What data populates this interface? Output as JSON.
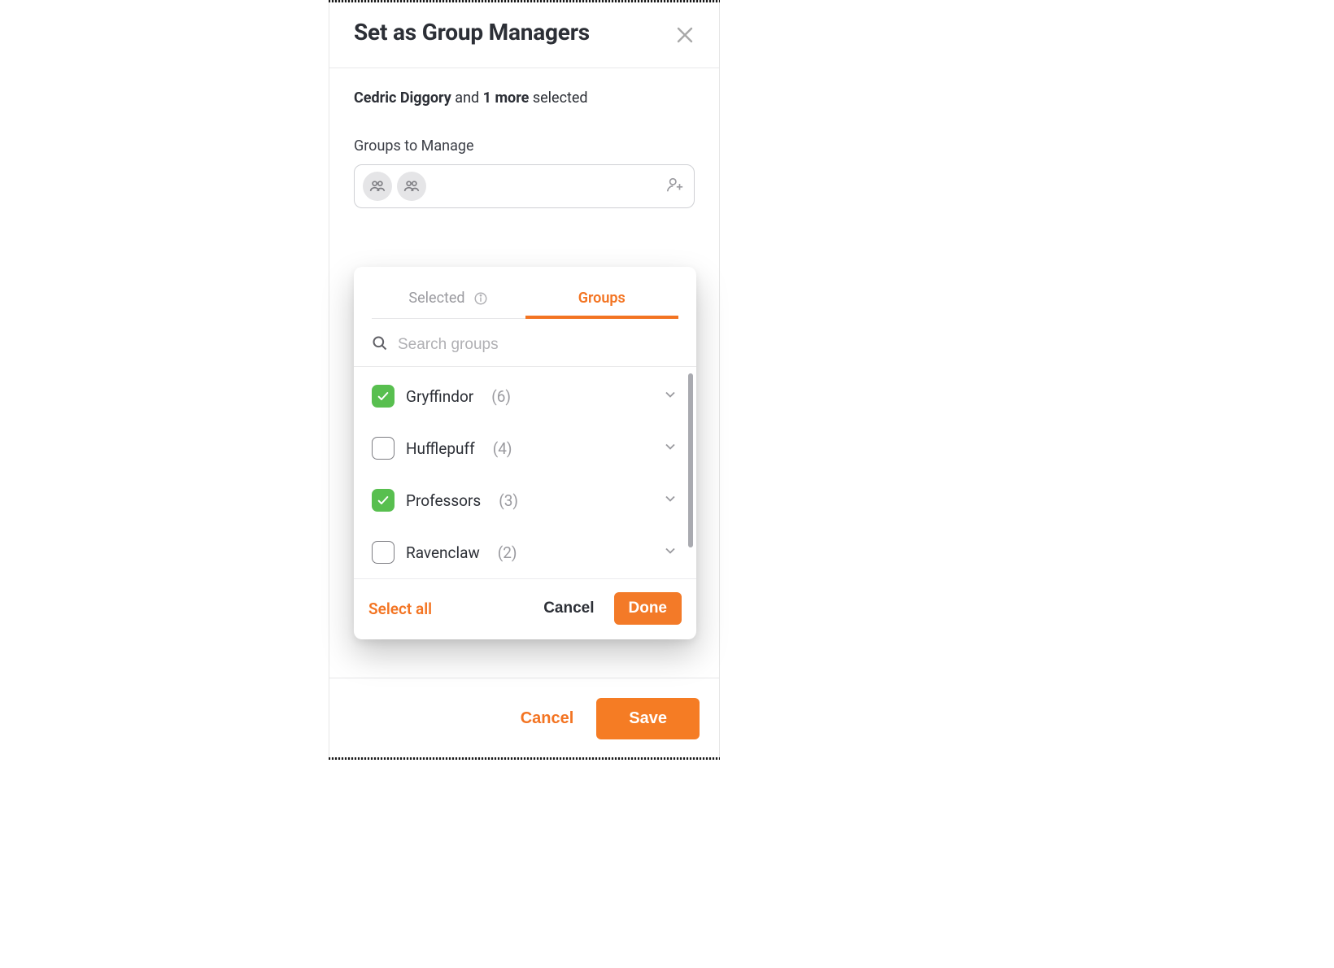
{
  "modal": {
    "title": "Set as Group Managers",
    "selection": {
      "name": "Cedric Diggory",
      "middle_text": " and ",
      "more_count": "1 more",
      "trailing_text": " selected"
    },
    "section_label": "Groups to Manage"
  },
  "dropdown": {
    "tabs": {
      "selected": "Selected",
      "groups": "Groups"
    },
    "search_placeholder": "Search groups",
    "items": [
      {
        "name": "Gryffindor",
        "count": "(6)",
        "checked": true
      },
      {
        "name": "Hufflepuff",
        "count": "(4)",
        "checked": false
      },
      {
        "name": "Professors",
        "count": "(3)",
        "checked": true
      },
      {
        "name": "Ravenclaw",
        "count": "(2)",
        "checked": false
      }
    ],
    "footer": {
      "select_all": "Select all",
      "cancel": "Cancel",
      "done": "Done"
    }
  },
  "footer": {
    "cancel": "Cancel",
    "save": "Save"
  }
}
